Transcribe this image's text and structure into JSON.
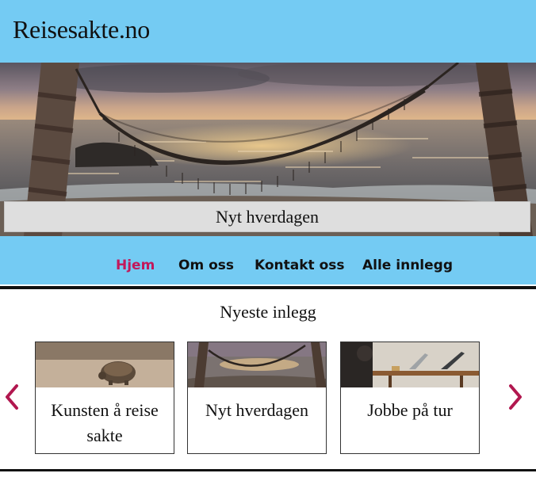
{
  "site": {
    "title": "Reisesakte.no"
  },
  "hero": {
    "caption": "Nyt hverdagen"
  },
  "nav": {
    "items": [
      {
        "label": "Hjem",
        "active": true
      },
      {
        "label": "Om oss",
        "active": false
      },
      {
        "label": "Kontakt oss",
        "active": false
      },
      {
        "label": "Alle innlegg",
        "active": false
      }
    ]
  },
  "latest": {
    "heading": "Nyeste inlegg",
    "cards": [
      {
        "title": "Kunsten å reise sakte",
        "image": "tortoise-photo"
      },
      {
        "title": "Nyt hverdagen",
        "image": "hammock-beach-photo"
      },
      {
        "title": "Jobbe på tur",
        "image": "laptop-desk-photo"
      }
    ],
    "prev_icon": "chevron-left-icon",
    "next_icon": "chevron-right-icon"
  },
  "colors": {
    "header_bg": "#74cbf3",
    "accent": "#c2185b",
    "caption_bg": "#dedede"
  }
}
